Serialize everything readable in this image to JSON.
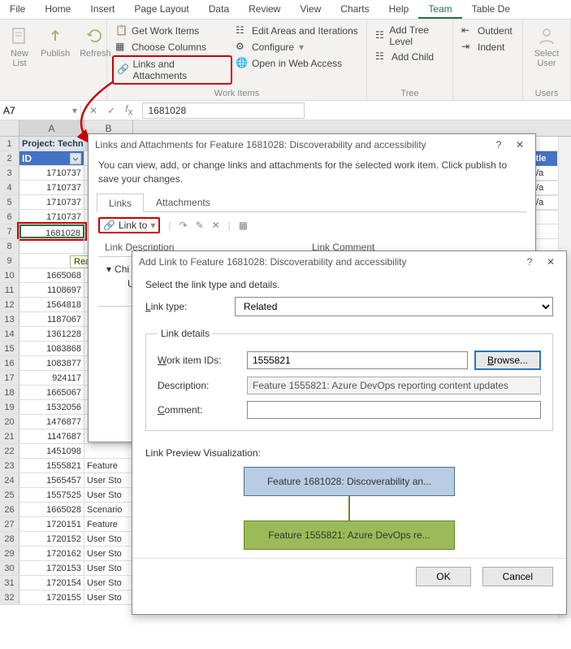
{
  "ribbon": {
    "tabs": [
      "File",
      "Home",
      "Insert",
      "Page Layout",
      "Data",
      "Review",
      "View",
      "Charts",
      "Help",
      "Team",
      "Table De"
    ],
    "active_tab": "Team",
    "group_newlist": {
      "label": "New\nList"
    },
    "group_publish": {
      "label": "Publish"
    },
    "group_refresh": {
      "label": "Refresh"
    },
    "work_items": {
      "get": "Get Work Items",
      "choose": "Choose Columns",
      "links": "Links and Attachments",
      "edit_areas": "Edit Areas and Iterations",
      "configure": "Configure",
      "open_web": "Open in Web Access",
      "label": "Work Items"
    },
    "tree": {
      "add_tree": "Add Tree Level",
      "add_child": "Add Child",
      "outdent": "Outdent",
      "indent": "Indent",
      "label": "Tree"
    },
    "users": {
      "select": "Select\nUser",
      "label": "Users"
    }
  },
  "namebox": "A7",
  "formula": "1681028",
  "sheet": {
    "col_heads": [
      "A",
      "B"
    ],
    "project_row": "Project: Techn",
    "headers": {
      "id": "ID",
      "title": "Title"
    },
    "cut_vals": [
      "f |  /a",
      "f |  /a",
      "f |  /a"
    ],
    "rows": [
      {
        "n": 3,
        "id": "1710737"
      },
      {
        "n": 4,
        "id": "1710737"
      },
      {
        "n": 5,
        "id": "1710737"
      },
      {
        "n": 6,
        "id": "1710737"
      },
      {
        "n": 7,
        "id": "1681028"
      },
      {
        "n": 8,
        "id": ""
      },
      {
        "n": 9,
        "id": ""
      },
      {
        "n": 10,
        "id": "1665068"
      },
      {
        "n": 11,
        "id": "1108697"
      },
      {
        "n": 12,
        "id": "1564818"
      },
      {
        "n": 13,
        "id": "1187067"
      },
      {
        "n": 14,
        "id": "1361228"
      },
      {
        "n": 15,
        "id": "1083868"
      },
      {
        "n": 16,
        "id": "1083877"
      },
      {
        "n": 17,
        "id": "924117"
      },
      {
        "n": 18,
        "id": "1665067"
      },
      {
        "n": 19,
        "id": "1532056"
      },
      {
        "n": 20,
        "id": "1476877"
      },
      {
        "n": 21,
        "id": "1147687"
      },
      {
        "n": 22,
        "id": "1451098"
      },
      {
        "n": 23,
        "id": "1555821",
        "b": "Feature"
      },
      {
        "n": 24,
        "id": "1565457",
        "b": "User Sto"
      },
      {
        "n": 25,
        "id": "1557525",
        "b": "User Sto"
      },
      {
        "n": 26,
        "id": "1665028",
        "b": "Scenario"
      },
      {
        "n": 27,
        "id": "1720151",
        "b": "Feature"
      },
      {
        "n": 28,
        "id": "1720152",
        "b": "User Sto"
      },
      {
        "n": 29,
        "id": "1720162",
        "b": "User Sto"
      },
      {
        "n": 30,
        "id": "1720153",
        "b": "User Sto"
      },
      {
        "n": 31,
        "id": "1720154",
        "b": "User Sto"
      },
      {
        "n": 32,
        "id": "1720155",
        "b": "User Sto"
      }
    ],
    "tooltip": "Read-"
  },
  "dlg1": {
    "title": "Links and Attachments for Feature 1681028: Discoverability and accessibility",
    "intro": "You can view, add, or change links and attachments for the selected work item. Click publish to save your changes.",
    "tabs": [
      "Links",
      "Attachments"
    ],
    "link_to": "Link to",
    "cols": {
      "desc": "Link Description",
      "comment": "Link Comment"
    },
    "rows": {
      "chi": "Chi",
      "us": "Us"
    }
  },
  "dlg2": {
    "title": "Add Link to Feature 1681028: Discoverability and accessibility",
    "intro": "Select the link type and details.",
    "link_type_label": "Link type:",
    "link_type_value": "Related",
    "details_legend": "Link details",
    "work_ids_label": "Work item IDs:",
    "work_ids_value": "1555821",
    "browse": "Browse...",
    "desc_label": "Description:",
    "desc_value": "Feature 1555821: Azure DevOps reporting content updates",
    "comment_label": "Comment:",
    "comment_value": "",
    "preview_label": "Link Preview Visualization:",
    "node1": "Feature 1681028: Discoverability an...",
    "node2": "Feature 1555821: Azure DevOps re...",
    "ok": "OK",
    "cancel": "Cancel"
  }
}
